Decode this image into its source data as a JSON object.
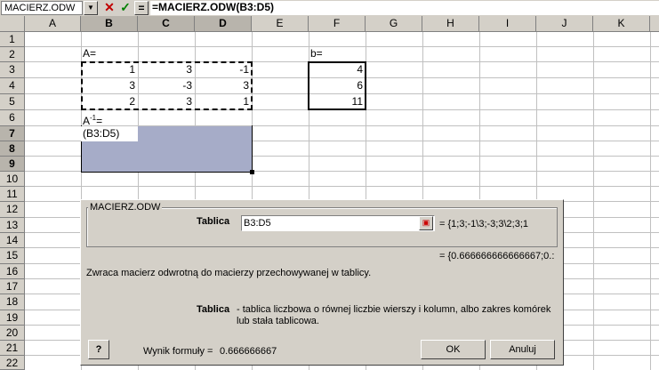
{
  "formula_bar": {
    "name_box": "MACIERZ.ODW",
    "cancel_icon": "✕",
    "enter_icon": "✓",
    "equals_label": "=",
    "formula": "=MACIERZ.ODW(B3:D5)"
  },
  "columns": [
    "A",
    "B",
    "C",
    "D",
    "E",
    "F",
    "G",
    "H",
    "I",
    "J",
    "K"
  ],
  "rows": [
    "1",
    "2",
    "3",
    "4",
    "5",
    "6",
    "7",
    "8",
    "9",
    "10",
    "11",
    "12",
    "13",
    "14",
    "15",
    "16",
    "17",
    "18",
    "19",
    "20",
    "21",
    "22"
  ],
  "cells": {
    "B2": "A=",
    "F2": "b=",
    "B3": "1",
    "C3": "3",
    "D3": "-1",
    "B4": "3",
    "C4": "-3",
    "D4": "3",
    "B5": "2",
    "C5": "3",
    "D5": "1",
    "B6": "A",
    "B6_sup": "-1",
    "B6_eq": "=",
    "B7": "(B3:D5)",
    "F3": "4",
    "F4": "6",
    "F5": "11"
  },
  "dialog": {
    "function_name": "MACIERZ.ODW",
    "arg_label": "Tablica",
    "arg_value": "B3:D5",
    "arg_result": "= {1;3;-1\\3;-3;3\\2;3;1",
    "total_result": "= {0.666666666666667;0.:",
    "description": "Zwraca macierz odwrotną do macierzy przechowywanej w tablicy.",
    "param_name": "Tablica",
    "param_desc_line1": "- tablica liczbowa o równej liczbie wierszy i kolumn, albo zakres komórek",
    "param_desc_line2": "lub stała tablicowa.",
    "formula_result_label": "Wynik formuły =",
    "formula_result_value": "0.666666667",
    "ok_label": "OK",
    "cancel_label": "Anuluj",
    "help_icon": "?"
  }
}
